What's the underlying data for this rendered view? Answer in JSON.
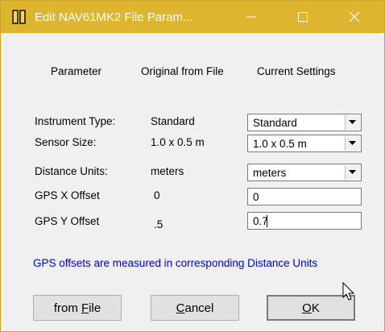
{
  "window": {
    "title": "Edit NAV61MK2 File Param...",
    "title_bar_color": "#ddb52f",
    "icons": [
      "app-icon",
      "minimize-icon",
      "maximize-icon",
      "close-icon"
    ]
  },
  "headers": {
    "parameter": "Parameter",
    "original": "Original from File",
    "current": "Current Settings"
  },
  "rows": [
    {
      "label": "Instrument Type:",
      "original": "Standard",
      "current": "Standard",
      "control": "dropdown"
    },
    {
      "label": "Sensor Size:",
      "original": "1.0 x 0.5 m",
      "current": "1.0 x 0.5 m",
      "control": "dropdown"
    },
    {
      "label": "Distance Units:",
      "original": "meters",
      "current": "meters",
      "control": "dropdown"
    },
    {
      "label": "GPS X Offset",
      "original": "0",
      "current": "0",
      "control": "text"
    },
    {
      "label": "GPS Y Offset",
      "original": ".5",
      "current": "0.7",
      "control": "text"
    }
  ],
  "note": {
    "text": "GPS offsets are measured in corresponding Distance Units",
    "color": "#0000ee"
  },
  "buttons": {
    "from_file_prefix": "from ",
    "from_file_mnemonic": "F",
    "from_file_rest": "ile",
    "cancel_mnemonic": "C",
    "cancel_rest": "ancel",
    "ok_mnemonic": "O",
    "ok_rest": "K"
  }
}
